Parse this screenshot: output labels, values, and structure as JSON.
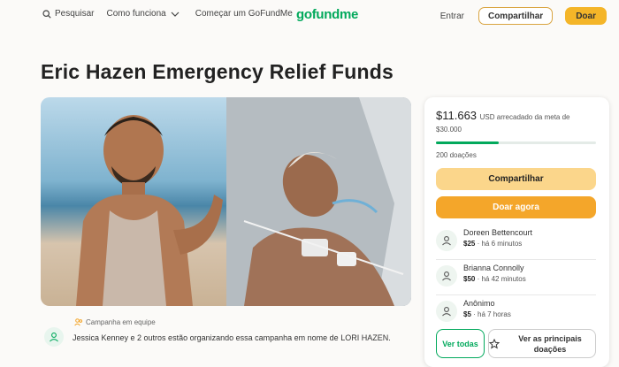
{
  "nav": {
    "search_label": "Pesquisar",
    "how_label": "Como funciona",
    "start_label": "Começar um GoFundMe",
    "logo_text": "gofundme",
    "signin_label": "Entrar",
    "share_label": "Compartilhar",
    "donate_label": "Doar"
  },
  "campaign": {
    "title": "Eric Hazen Emergency Relief Funds",
    "team_tag": "Campanha em equipe",
    "organizer_text": "Jessica Kenney e 2 outros estão organizando essa campanha em nome de LORI HAZEN."
  },
  "sidebar": {
    "raised_amount": "$11.663",
    "raised_suffix": "USD arrecadado da meta de",
    "goal": "$30.000",
    "progress_fraction": 0.39,
    "donation_count": "200 doações",
    "share_button": "Compartilhar",
    "donate_button": "Doar agora",
    "donations": [
      {
        "name": "Doreen Bettencourt",
        "amount": "$25",
        "time": "há 6 minutos"
      },
      {
        "name": "Brianna Connolly",
        "amount": "$50",
        "time": "há 42 minutos"
      },
      {
        "name": "Anônimo",
        "amount": "$5",
        "time": "há 7 horas"
      }
    ],
    "see_all_button": "Ver todas",
    "see_top_button": "Ver as principais doações"
  },
  "colors": {
    "brand_green": "#02a95c",
    "donate_orange": "#f4a62a",
    "share_yellow": "#fbd68b"
  }
}
